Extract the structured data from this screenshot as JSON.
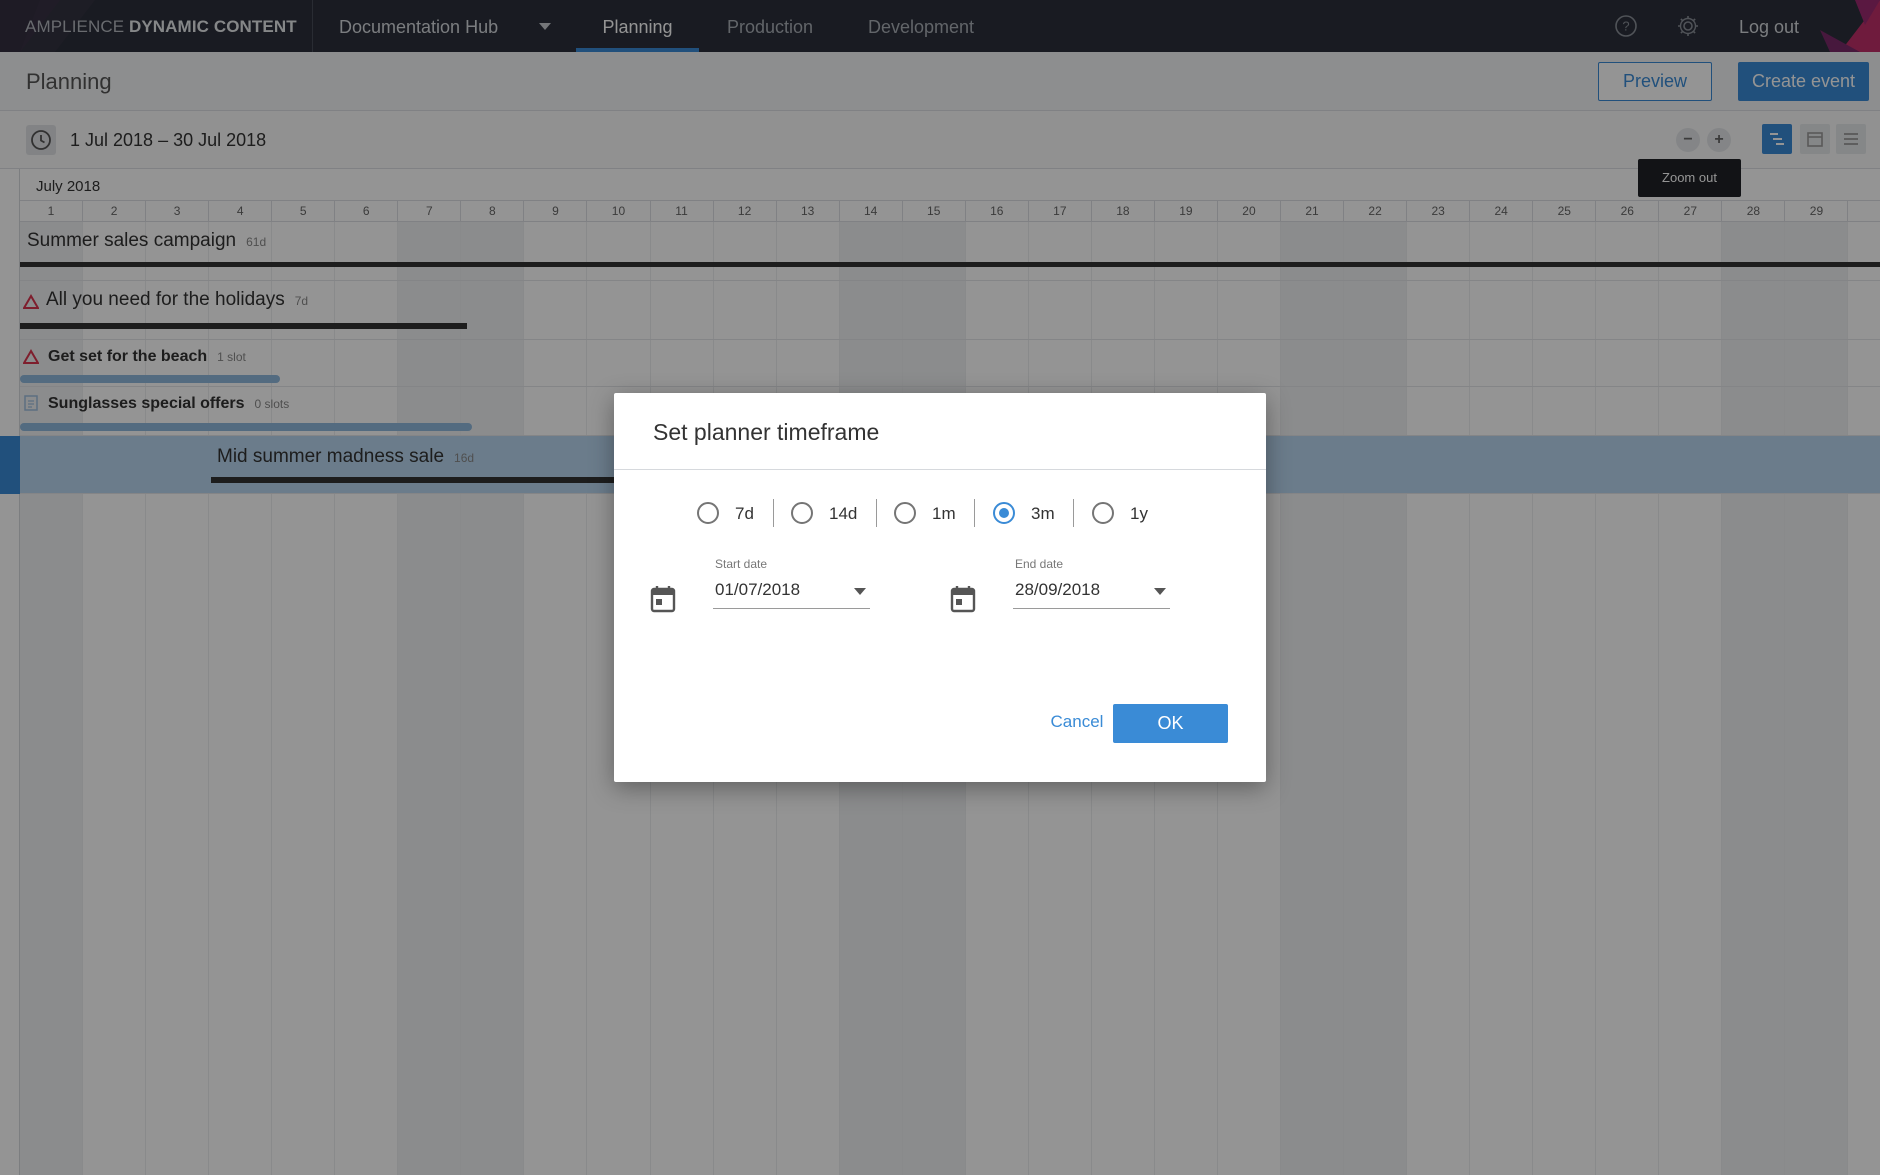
{
  "brand": {
    "light": "AMPLIENCE",
    "bold": "DYNAMIC CONTENT"
  },
  "nav": {
    "hub": "Documentation Hub",
    "tabs": [
      {
        "label": "Planning",
        "active": true
      },
      {
        "label": "Production",
        "active": false
      },
      {
        "label": "Development",
        "active": false
      }
    ],
    "logout": "Log out"
  },
  "page": {
    "title": "Planning",
    "preview_label": "Preview",
    "create_label": "Create event"
  },
  "toolbar": {
    "range": "1 Jul 2018 – 30 Jul 2018",
    "zoom_out_symbol": "−",
    "zoom_in_symbol": "+",
    "tooltip": "Zoom out"
  },
  "timeline": {
    "month": "July 2018",
    "days": [
      "1",
      "2",
      "3",
      "4",
      "5",
      "6",
      "7",
      "8",
      "9",
      "10",
      "11",
      "12",
      "13",
      "14",
      "15",
      "16",
      "17",
      "18",
      "19",
      "20",
      "21",
      "22",
      "23",
      "24",
      "25",
      "26",
      "27",
      "28",
      "29"
    ],
    "events": [
      {
        "title": "Summer sales campaign",
        "duration": "61d"
      },
      {
        "title": "All you need for the holidays",
        "duration": "7d"
      },
      {
        "title": "Get set for the beach",
        "duration": "1 slot"
      },
      {
        "title": "Sunglasses special offers",
        "duration": "0 slots"
      },
      {
        "title": "Mid summer madness sale",
        "duration": "16d"
      }
    ]
  },
  "dialog": {
    "title": "Set planner timeframe",
    "options": [
      {
        "label": "7d",
        "checked": false
      },
      {
        "label": "14d",
        "checked": false
      },
      {
        "label": "1m",
        "checked": false
      },
      {
        "label": "3m",
        "checked": true
      },
      {
        "label": "1y",
        "checked": false
      }
    ],
    "start": {
      "label": "Start date",
      "value": "01/07/2018"
    },
    "end": {
      "label": "End date",
      "value": "28/09/2018"
    },
    "cancel_label": "Cancel",
    "ok_label": "OK"
  },
  "colors": {
    "accent": "#3a8bd6",
    "nav_bg": "#2b303b",
    "warning": "#d9344f"
  }
}
